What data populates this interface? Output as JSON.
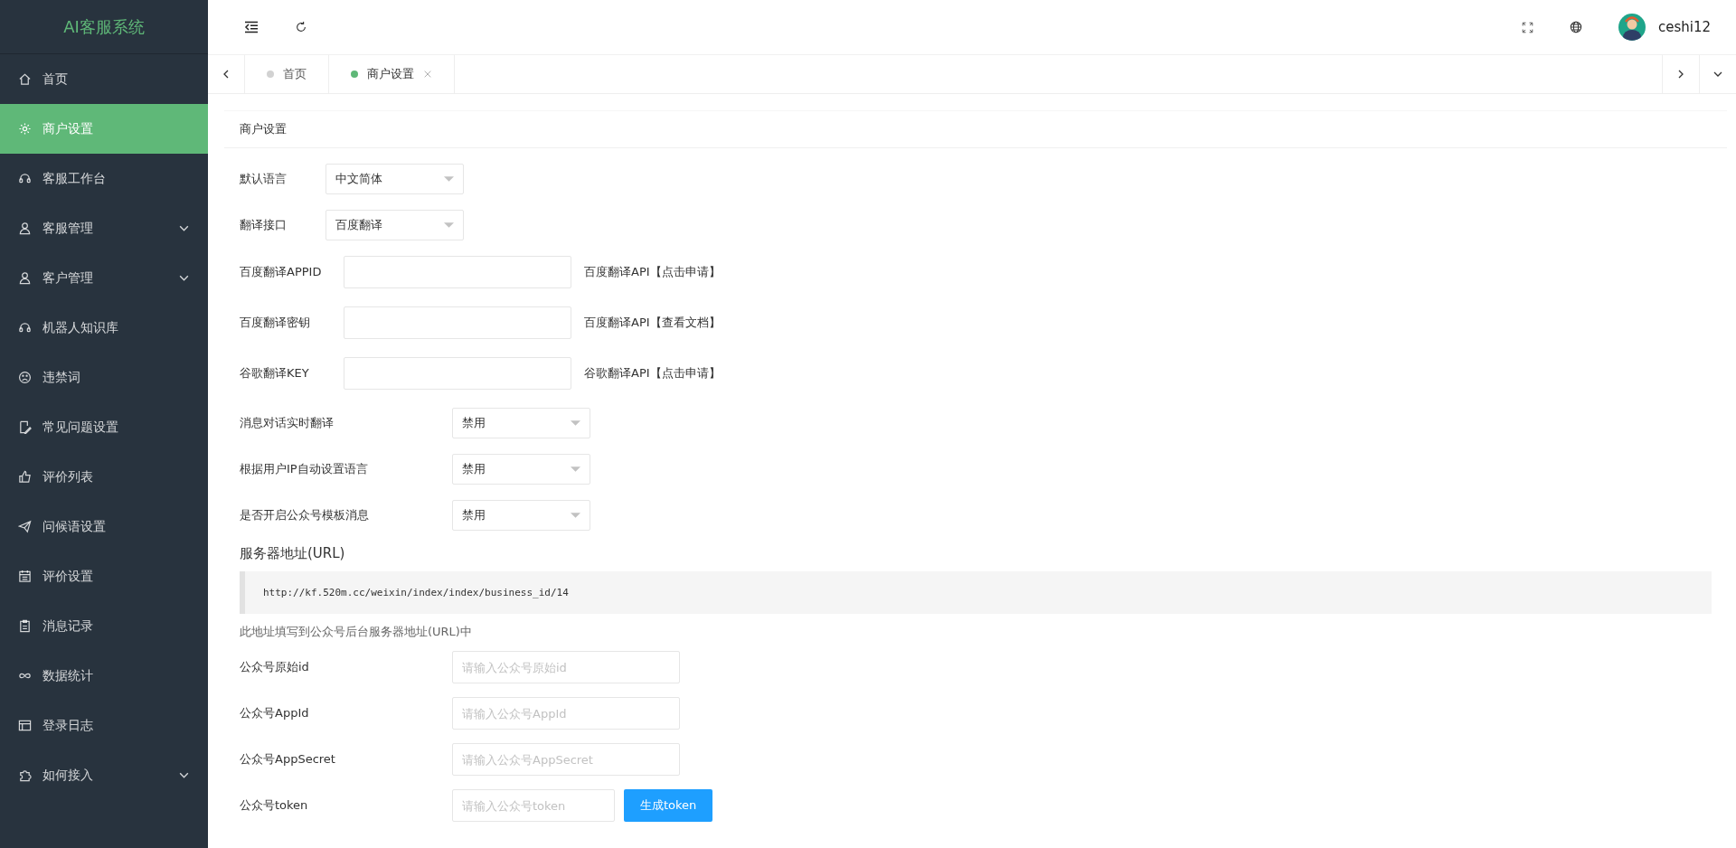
{
  "sidebar": {
    "logo": "AI客服系统",
    "items": [
      {
        "label": "首页",
        "kind": "link",
        "selected": false
      },
      {
        "label": "商户设置",
        "kind": "link",
        "selected": true
      },
      {
        "label": "客服工作台",
        "kind": "link",
        "selected": false
      },
      {
        "label": "客服管理",
        "kind": "group",
        "selected": false
      },
      {
        "label": "客户管理",
        "kind": "group",
        "selected": false
      },
      {
        "label": "机器人知识库",
        "kind": "link",
        "selected": false
      },
      {
        "label": "违禁词",
        "kind": "link",
        "selected": false
      },
      {
        "label": "常见问题设置",
        "kind": "link",
        "selected": false
      },
      {
        "label": "评价列表",
        "kind": "link",
        "selected": false
      },
      {
        "label": "问候语设置",
        "kind": "link",
        "selected": false
      },
      {
        "label": "评价设置",
        "kind": "link",
        "selected": false
      },
      {
        "label": "消息记录",
        "kind": "link",
        "selected": false
      },
      {
        "label": "数据统计",
        "kind": "link",
        "selected": false
      },
      {
        "label": "登录日志",
        "kind": "link",
        "selected": false
      },
      {
        "label": "如何接入",
        "kind": "group",
        "selected": false
      }
    ]
  },
  "header": {
    "username": "ceshi12"
  },
  "tabs": [
    {
      "label": "首页",
      "selected": false
    },
    {
      "label": "商户设置",
      "selected": true
    }
  ],
  "card": {
    "title": "商户设置",
    "language_settings": [
      {
        "label": "默认语言",
        "value": "中文简体"
      },
      {
        "label": "翻译接口",
        "value": "百度翻译"
      }
    ],
    "translation_keys": [
      {
        "label": "百度翻译APPID",
        "link": "百度翻译API【点击申请】"
      },
      {
        "label": "百度翻译密钥",
        "link": "百度翻译API【查看文档】"
      },
      {
        "label": "谷歌翻译KEY",
        "link": "谷歌翻译API【点击申请】"
      }
    ],
    "switches": [
      {
        "label": "消息对话实时翻译",
        "value": "禁用"
      },
      {
        "label": "根据用户IP自动设置语言",
        "value": "禁用"
      },
      {
        "label": "是否开启公众号模板消息",
        "value": "禁用"
      }
    ],
    "server_url": {
      "heading": "服务器地址(URL)",
      "url": "http://kf.520m.cc/weixin/index/index/business_id/14",
      "note": "此地址填写到公众号后台服务器地址(URL)中"
    },
    "official_account": [
      {
        "label": "公众号原始id",
        "placeholder": "请输入公众号原始id"
      },
      {
        "label": "公众号AppId",
        "placeholder": "请输入公众号AppId"
      },
      {
        "label": "公众号AppSecret",
        "placeholder": "请输入公众号AppSecret"
      },
      {
        "label": "公众号token",
        "placeholder": "请输入公众号token",
        "button": "生成token"
      }
    ]
  }
}
